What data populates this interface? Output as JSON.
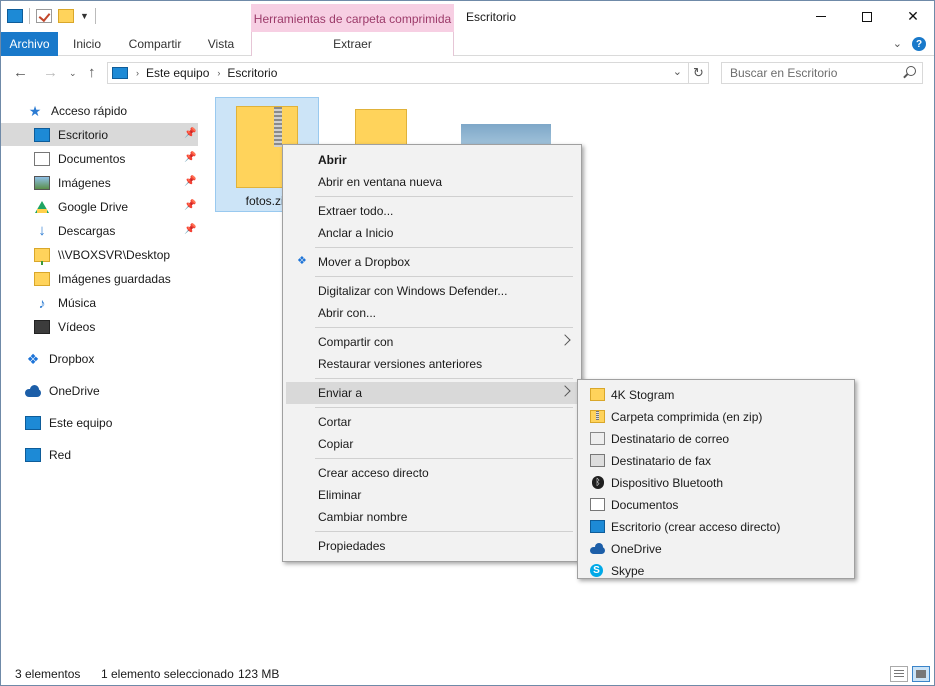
{
  "titlebar": {
    "context_tab_header": "Herramientas de carpeta comprimida",
    "window_title": "Escritorio",
    "minimize": "—",
    "close": "✕"
  },
  "ribbon": {
    "tabs": [
      "Archivo",
      "Inicio",
      "Compartir",
      "Vista",
      "Extraer"
    ],
    "expand_symbol": "⌄",
    "help_symbol": "?"
  },
  "navigation": {
    "back": "←",
    "forward": "→",
    "recent": "⌄",
    "up": "↑",
    "breadcrumbs": [
      "Este equipo",
      "Escritorio"
    ],
    "separator": "›",
    "dropdown": "⌄",
    "refresh": "↻"
  },
  "search": {
    "placeholder": "Buscar en Escritorio"
  },
  "sidebar": {
    "quick_access": "Acceso rápido",
    "quick_access_symbol": "★",
    "pinned": [
      "Escritorio",
      "Documentos",
      "Imágenes",
      "Google Drive",
      "Descargas"
    ],
    "pin_symbol": "📌",
    "download_symbol": "↓",
    "music_symbol": "♪",
    "dropbox_symbol": "❖",
    "other": [
      "\\\\VBOXSVR\\Desktop",
      "Imágenes guardadas",
      "Música",
      "Vídeos"
    ],
    "roots": [
      "Dropbox",
      "OneDrive",
      "Este equipo",
      "Red"
    ]
  },
  "content": {
    "files": [
      {
        "name": "fotos.zip",
        "type": "zip",
        "selected": true
      },
      {
        "name": "",
        "type": "folder"
      },
      {
        "name": "",
        "type": "image"
      }
    ]
  },
  "context_menu": {
    "items": [
      {
        "label": "Abrir",
        "bold": true
      },
      {
        "label": "Abrir en ventana nueva"
      },
      {
        "label": "Extraer todo..."
      },
      {
        "label": "Anclar a Inicio"
      },
      {
        "label": "Mover a Dropbox",
        "icon": "dropbox-icon"
      },
      {
        "label": "Digitalizar con Windows Defender..."
      },
      {
        "label": "Abrir con..."
      },
      {
        "label": "Compartir con",
        "submenu": true
      },
      {
        "label": "Restaurar versiones anteriores"
      },
      {
        "label": "Enviar a",
        "submenu": true,
        "highlighted": true
      },
      {
        "label": "Cortar"
      },
      {
        "label": "Copiar"
      },
      {
        "label": "Crear acceso directo"
      },
      {
        "label": "Eliminar"
      },
      {
        "label": "Cambiar nombre"
      },
      {
        "label": "Propiedades"
      }
    ]
  },
  "send_to_menu": {
    "items": [
      "4K Stogram",
      "Carpeta comprimida (en zip)",
      "Destinatario de correo",
      "Destinatario de fax",
      "Dispositivo Bluetooth",
      "Documentos",
      "Escritorio (crear acceso directo)",
      "OneDrive",
      "Skype"
    ],
    "bluetooth_symbol": "ᛒ",
    "skype_symbol": "S"
  },
  "statusbar": {
    "count": "3 elementos",
    "selection": "1 elemento seleccionado",
    "size": "123 MB"
  }
}
